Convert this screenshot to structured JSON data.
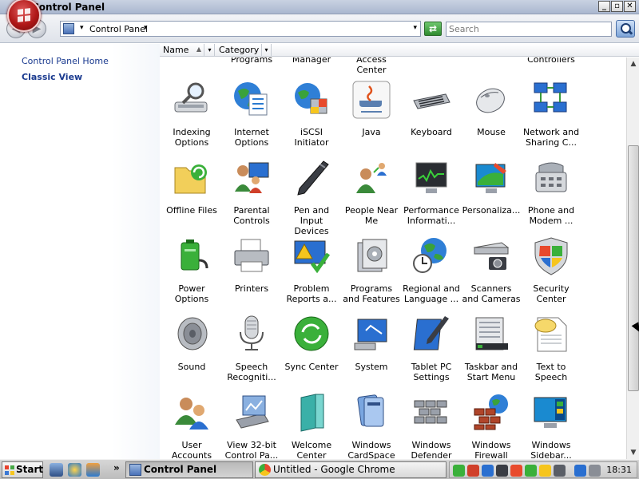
{
  "window": {
    "title": "Control Panel"
  },
  "address": {
    "breadcrumb": "Control Panel",
    "search_placeholder": "Search"
  },
  "nav": {
    "home_link": "Control Panel Home",
    "classic_view": "Classic View"
  },
  "columns": {
    "name": "Name",
    "category": "Category"
  },
  "partial_row": [
    "Programs",
    "Manager",
    "Access Center",
    "Controllers"
  ],
  "items": [
    [
      "Indexing Options",
      "Internet Options",
      "iSCSI Initiator",
      "Java",
      "Keyboard",
      "Mouse",
      "Network and Sharing C..."
    ],
    [
      "Offline Files",
      "Parental Controls",
      "Pen and Input Devices",
      "People Near Me",
      "Performance Informati...",
      "Personaliza...",
      "Phone and Modem ..."
    ],
    [
      "Power Options",
      "Printers",
      "Problem Reports a...",
      "Programs and Features",
      "Regional and Language ...",
      "Scanners and Cameras",
      "Security Center"
    ],
    [
      "Sound",
      "Speech Recogniti...",
      "Sync Center",
      "System",
      "Tablet PC Settings",
      "Taskbar and Start Menu",
      "Text to Speech"
    ],
    [
      "User Accounts",
      "View 32-bit Control Pa...",
      "Welcome Center",
      "Windows CardSpace",
      "Windows Defender",
      "Windows Firewall",
      "Windows Sidebar..."
    ]
  ],
  "taskbar": {
    "start": "Start",
    "tasks": [
      "Control Panel",
      "Untitled - Google Chrome"
    ],
    "clock": "18:31"
  },
  "colors": {
    "link": "#1a3a8f",
    "accent": "#4a72b8"
  }
}
